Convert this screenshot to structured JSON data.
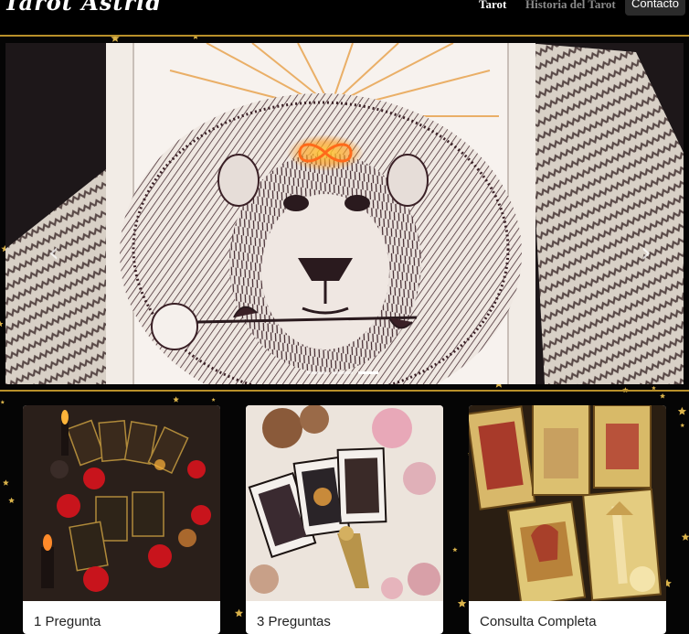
{
  "brand": {
    "name": "Tarot Astrid"
  },
  "nav": {
    "items": [
      {
        "label": "Tarot"
      },
      {
        "label": "Historia del Tarot"
      },
      {
        "label": "Contacto"
      }
    ]
  },
  "carousel": {
    "prev_icon": "‹",
    "next_icon": "›",
    "slide_count": 3,
    "active_slide": 3
  },
  "cards": [
    {
      "title": "1 Pregunta"
    },
    {
      "title": "3 Preguntas"
    },
    {
      "title": "Consulta Completa"
    }
  ],
  "colors": {
    "navbar_bg": "#000000",
    "accent_gold": "#b8902a",
    "contact_button_bg": "#2b2b2b"
  }
}
